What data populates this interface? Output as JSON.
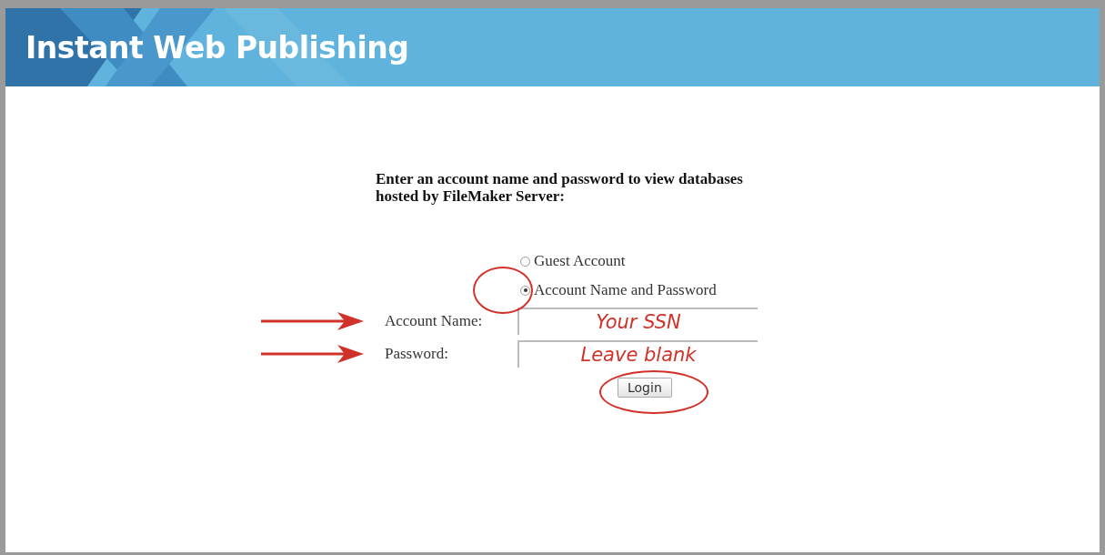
{
  "header": {
    "title": "Instant Web Publishing"
  },
  "instructions": "Enter an account name and password to view databases hosted by FileMaker Server:",
  "login_options": [
    {
      "label": "Guest Account",
      "selected": false,
      "circled": false
    },
    {
      "label": "Account Name and Password",
      "selected": true,
      "circled": true
    }
  ],
  "fields": [
    {
      "label": "Account Name:",
      "value": "Your SSN",
      "arrowed": true
    },
    {
      "label": "Password:",
      "value": "Leave blank",
      "arrowed": true
    }
  ],
  "login_button": {
    "label": "Login",
    "circled": true
  }
}
